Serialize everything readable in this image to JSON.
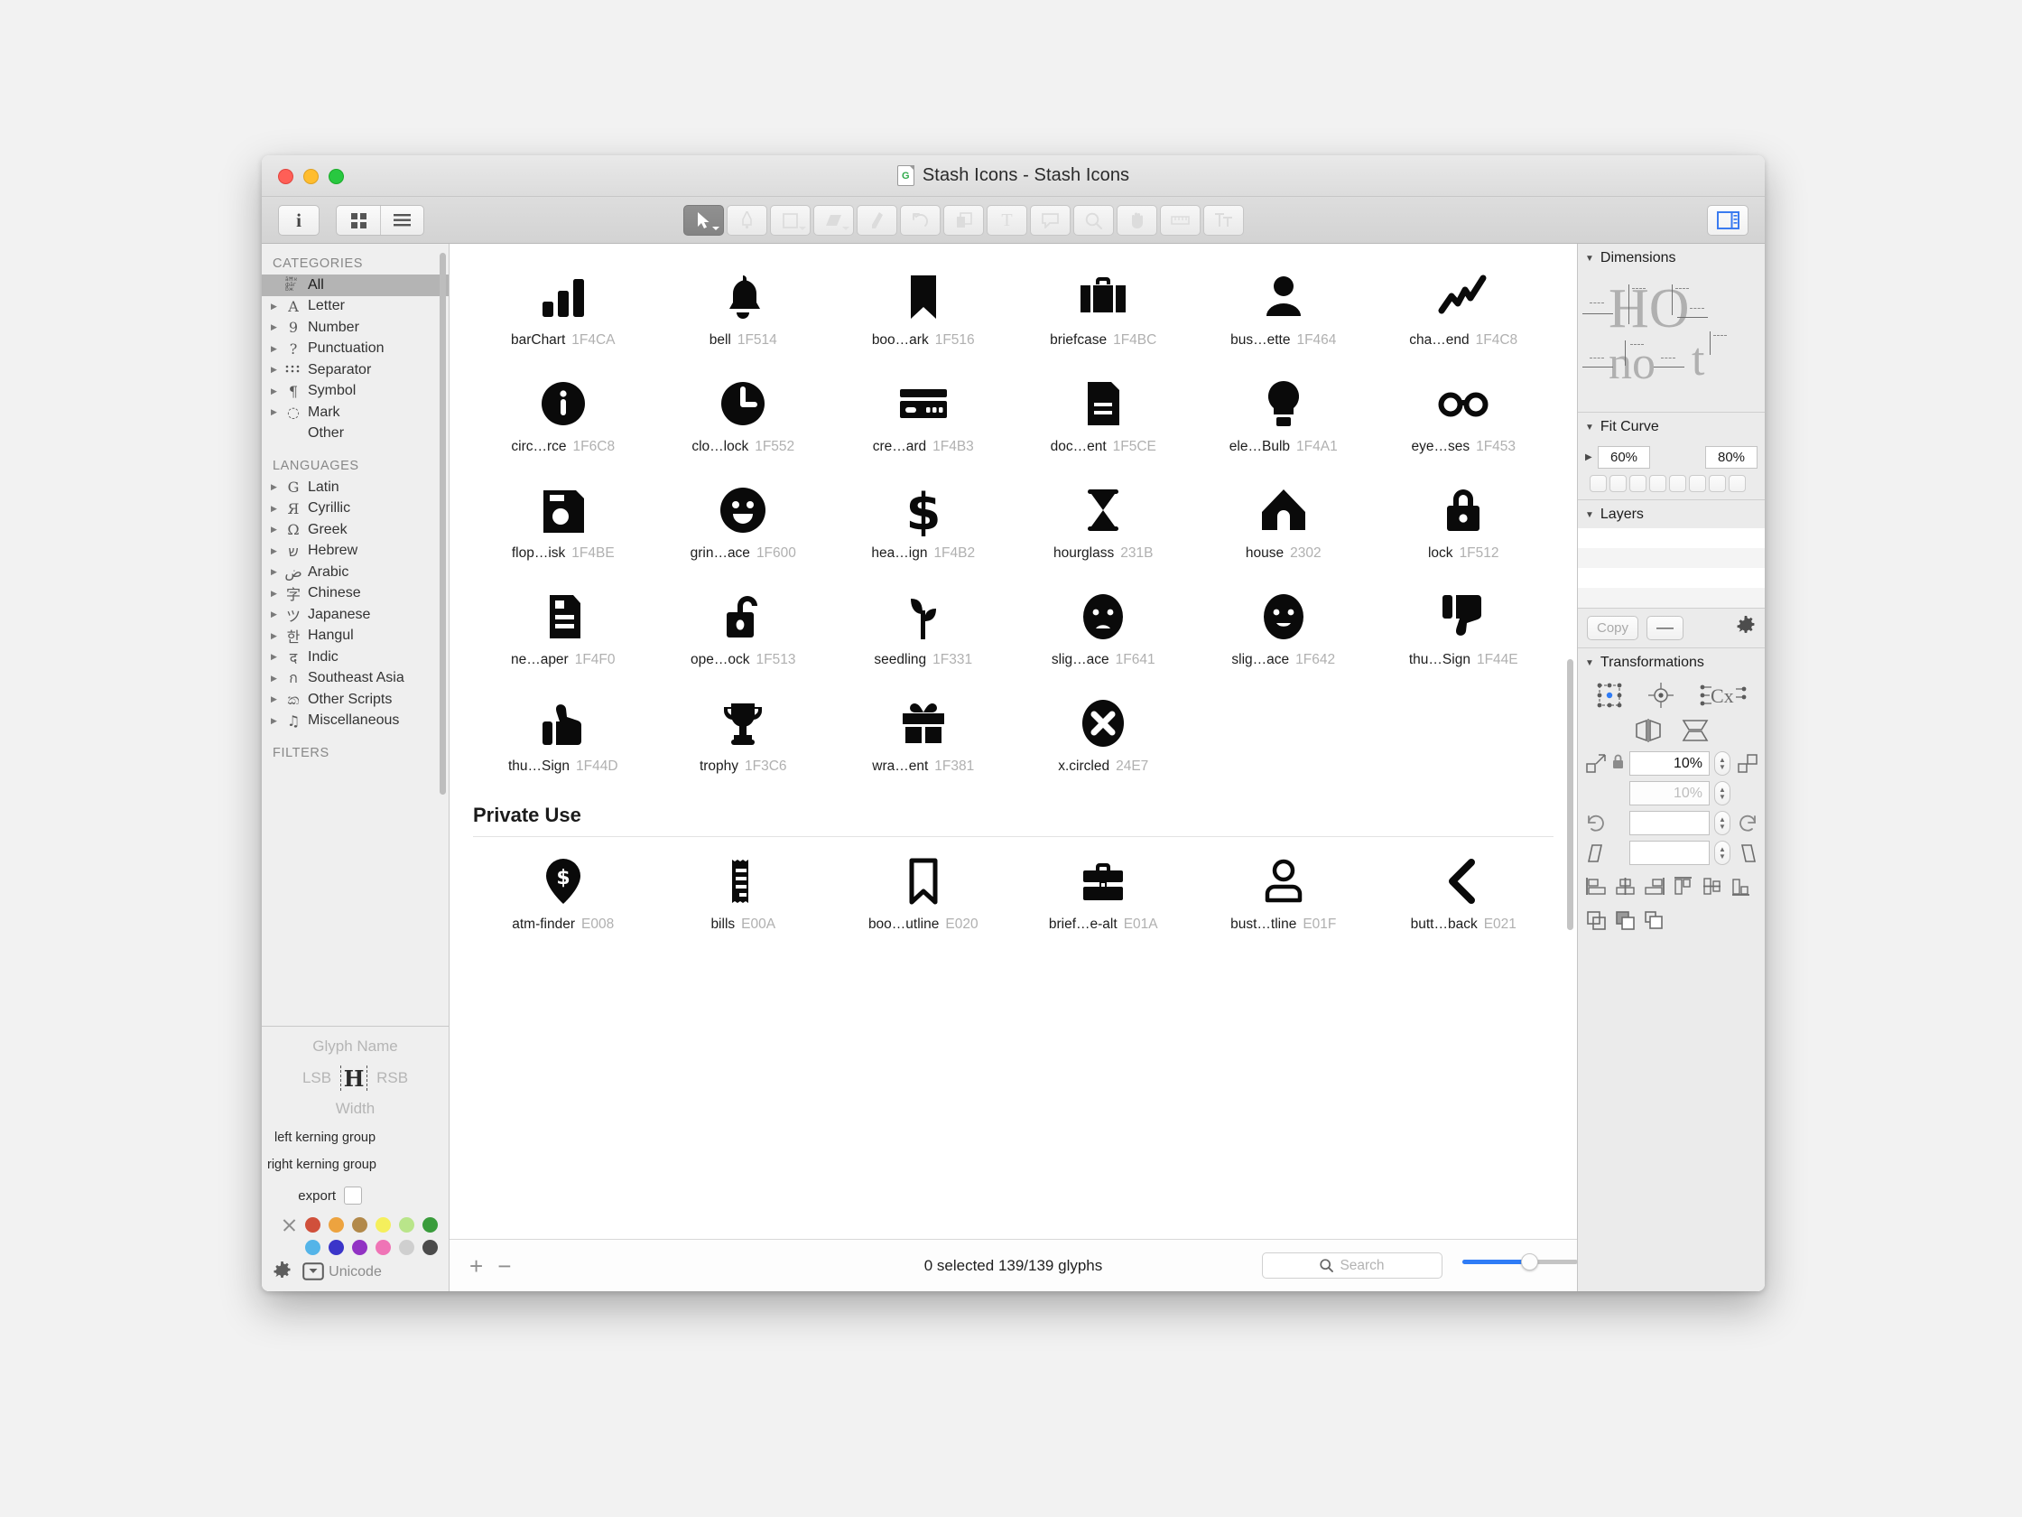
{
  "window": {
    "title": "Stash Icons - Stash Icons",
    "doc_badge_letter": "G",
    "traffic": {
      "close": "close-button",
      "minimize": "minimize-button",
      "zoom": "zoom-button"
    }
  },
  "toolbar": {
    "info_label": "i",
    "view_grid_label": "grid-view",
    "view_list_label": "list-view",
    "tools": [
      {
        "name": "select-tool",
        "selected": true,
        "has_menu": true
      },
      {
        "name": "pen-tool",
        "selected": false,
        "has_menu": false
      },
      {
        "name": "shape-tool",
        "selected": false,
        "has_menu": true
      },
      {
        "name": "eraser-tool",
        "selected": false,
        "has_menu": true
      },
      {
        "name": "pencil-tool",
        "selected": false,
        "has_menu": false
      },
      {
        "name": "undo-tool",
        "selected": false,
        "has_menu": false
      },
      {
        "name": "transform-tool",
        "selected": false,
        "has_menu": false
      },
      {
        "name": "text-tool",
        "selected": false,
        "has_menu": false
      },
      {
        "name": "annotate-tool",
        "selected": false,
        "has_menu": false
      },
      {
        "name": "zoom-tool",
        "selected": false,
        "has_menu": false
      },
      {
        "name": "hand-tool",
        "selected": false,
        "has_menu": false
      },
      {
        "name": "measure-tool",
        "selected": false,
        "has_menu": false
      },
      {
        "name": "metrics-tool",
        "selected": false,
        "has_menu": false
      }
    ],
    "inspector_toggle": "inspector-toggle",
    "accent_color": "#2f7cf6"
  },
  "sidebar": {
    "categories_header": "CATEGORIES",
    "categories": [
      {
        "label": "All",
        "glyph": "░",
        "expandable": false,
        "active": true,
        "special": "all"
      },
      {
        "label": "Letter",
        "glyph": "A",
        "expandable": true,
        "active": false,
        "serif": true
      },
      {
        "label": "Number",
        "glyph": "9",
        "expandable": true,
        "active": false,
        "serif": true
      },
      {
        "label": "Punctuation",
        "glyph": "?",
        "expandable": true,
        "active": false,
        "serif": true
      },
      {
        "label": "Separator",
        "glyph": "⸮",
        "expandable": true,
        "active": false,
        "special": "sep"
      },
      {
        "label": "Symbol",
        "glyph": "¶",
        "expandable": true,
        "active": false,
        "serif": true
      },
      {
        "label": "Mark",
        "glyph": "◌",
        "expandable": true,
        "active": false
      },
      {
        "label": "Other",
        "glyph": "",
        "expandable": false,
        "active": false
      }
    ],
    "languages_header": "LANGUAGES",
    "languages": [
      {
        "label": "Latin",
        "glyph": "G",
        "serif": true
      },
      {
        "label": "Cyrillic",
        "glyph": "Я",
        "serif": true
      },
      {
        "label": "Greek",
        "glyph": "Ω",
        "serif": true
      },
      {
        "label": "Hebrew",
        "glyph": "ש"
      },
      {
        "label": "Arabic",
        "glyph": "ض"
      },
      {
        "label": "Chinese",
        "glyph": "字"
      },
      {
        "label": "Japanese",
        "glyph": "ツ"
      },
      {
        "label": "Hangul",
        "glyph": "한"
      },
      {
        "label": "Indic",
        "glyph": "द"
      },
      {
        "label": "Southeast Asia",
        "glyph": "ก"
      },
      {
        "label": "Other Scripts",
        "glyph": "ක"
      },
      {
        "label": "Miscellaneous",
        "glyph": "♫"
      }
    ],
    "filters_header": "FILTERS"
  },
  "glyph_info": {
    "name_label": "Glyph Name",
    "lsb_label": "LSB",
    "rsb_label": "RSB",
    "sample_letter": "H",
    "width_label": "Width",
    "left_kerning_label": "left kerning group",
    "right_kerning_label": "right kerning group",
    "export_label": "export",
    "export_checked": false,
    "unicode_label": "Unicode",
    "swatch_row1": [
      "#d0503b",
      "#eda33f",
      "#b2894a",
      "#f5ef5c",
      "#b9e58a",
      "#3a9c3c"
    ],
    "swatch_row2": [
      "#54b4e8",
      "#3b35c9",
      "#9233c4",
      "#ef74b6",
      "#cfcfcf",
      "#4b4b4b"
    ],
    "no_color_label": "no-color"
  },
  "glyphs": {
    "main": [
      {
        "name": "barChart",
        "code": "1F4CA",
        "icon": "bar-chart-icon"
      },
      {
        "name": "bell",
        "code": "1F514",
        "icon": "bell-icon"
      },
      {
        "name": "boo…ark",
        "code": "1F516",
        "icon": "bookmark-icon"
      },
      {
        "name": "briefcase",
        "code": "1F4BC",
        "icon": "briefcase-icon"
      },
      {
        "name": "bus…ette",
        "code": "1F464",
        "icon": "bust-silhouette-icon"
      },
      {
        "name": "cha…end",
        "code": "1F4C8",
        "icon": "chart-uptrend-icon"
      },
      {
        "name": "circ…rce",
        "code": "1F6C8",
        "icon": "circled-info-source-icon"
      },
      {
        "name": "clo…lock",
        "code": "1F552",
        "icon": "clock-icon"
      },
      {
        "name": "cre…ard",
        "code": "1F4B3",
        "icon": "credit-card-icon"
      },
      {
        "name": "doc…ent",
        "code": "1F5CE",
        "icon": "document-icon"
      },
      {
        "name": "ele…Bulb",
        "code": "1F4A1",
        "icon": "electric-bulb-icon"
      },
      {
        "name": "eye…ses",
        "code": "1F453",
        "icon": "eyeglasses-icon"
      },
      {
        "name": "flop…isk",
        "code": "1F4BE",
        "icon": "floppy-disk-icon"
      },
      {
        "name": "grin…ace",
        "code": "1F600",
        "icon": "grinning-face-icon"
      },
      {
        "name": "hea…ign",
        "code": "1F4B2",
        "icon": "heavy-dollar-sign-icon"
      },
      {
        "name": "hourglass",
        "code": "231B",
        "icon": "hourglass-icon"
      },
      {
        "name": "house",
        "code": "2302",
        "icon": "house-icon"
      },
      {
        "name": "lock",
        "code": "1F512",
        "icon": "lock-icon"
      },
      {
        "name": "ne…aper",
        "code": "1F4F0",
        "icon": "newspaper-icon"
      },
      {
        "name": "ope…ock",
        "code": "1F513",
        "icon": "open-lock-icon"
      },
      {
        "name": "seedling",
        "code": "1F331",
        "icon": "seedling-icon"
      },
      {
        "name": "slig…ace",
        "code": "1F641",
        "icon": "slightly-frowning-face-icon"
      },
      {
        "name": "slig…ace",
        "code": "1F642",
        "icon": "slightly-smiling-face-icon"
      },
      {
        "name": "thu…Sign",
        "code": "1F44E",
        "icon": "thumbs-down-sign-icon"
      },
      {
        "name": "thu…Sign",
        "code": "1F44D",
        "icon": "thumbs-up-sign-icon"
      },
      {
        "name": "trophy",
        "code": "1F3C6",
        "icon": "trophy-icon"
      },
      {
        "name": "wra…ent",
        "code": "1F381",
        "icon": "wrapped-present-icon"
      },
      {
        "name": "x.circled",
        "code": "24E7",
        "icon": "x-circled-icon"
      }
    ],
    "private_use_header": "Private Use",
    "private_use": [
      {
        "name": "atm-finder",
        "code": "E008",
        "icon": "atm-finder-icon"
      },
      {
        "name": "bills",
        "code": "E00A",
        "icon": "bills-icon"
      },
      {
        "name": "boo…utline",
        "code": "E020",
        "icon": "bookmark-outline-icon"
      },
      {
        "name": "brief…e-alt",
        "code": "E01A",
        "icon": "briefcase-alt-icon"
      },
      {
        "name": "bust…tline",
        "code": "E01F",
        "icon": "bust-outline-icon"
      },
      {
        "name": "butt…back",
        "code": "E021",
        "icon": "button-back-icon"
      }
    ]
  },
  "status": {
    "add_label": "+",
    "remove_label": "−",
    "selection_text": "0 selected 139/139 glyphs",
    "search_placeholder": "Search",
    "zoom_percent": 58
  },
  "inspector": {
    "dimensions": {
      "title": "Dimensions",
      "expanded": true,
      "sample_upper": "HO",
      "sample_lower": "no",
      "sample_t": "t"
    },
    "fit_curve": {
      "title": "Fit Curve",
      "expanded": true,
      "min_percent": "60%",
      "max_percent": "80%",
      "cell_count": 8
    },
    "layers": {
      "title": "Layers",
      "expanded": true,
      "rows": 4,
      "copy_label": "Copy",
      "remove_label": "—",
      "gear_label": "layer-options"
    },
    "transformations": {
      "title": "Transformations",
      "expanded": true,
      "scale_value": "10%",
      "scale_value_secondary": "10%",
      "rotate_value": "",
      "slant_value": "",
      "lock_proportions": true
    }
  }
}
